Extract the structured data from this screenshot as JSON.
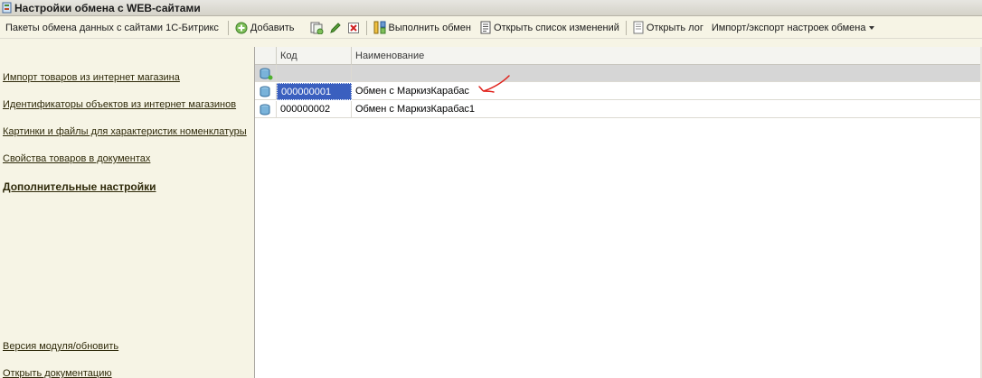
{
  "window": {
    "title": "Настройки обмена с WEB-сайтами"
  },
  "toolbar": {
    "section_label": "Пакеты обмена данных с сайтами 1С-Битрикс",
    "add_label": "Добавить",
    "run_exchange_label": "Выполнить обмен",
    "open_changes_label": "Открыть список изменений",
    "open_log_label": "Открыть лог",
    "import_export_label": "Импорт/экспорт настроек обмена"
  },
  "sidebar": {
    "links": [
      {
        "label": "Импорт товаров из интернет магазина"
      },
      {
        "label": "Идентификаторы объектов из интернет магазинов"
      },
      {
        "label": "Картинки и файлы для характеристик номенклатуры"
      },
      {
        "label": "Свойства товаров в документах"
      },
      {
        "label": "Дополнительные настройки"
      }
    ],
    "bottom_links": [
      {
        "label": "Версия модуля/обновить"
      },
      {
        "label": "Открыть документацию"
      }
    ]
  },
  "table": {
    "columns": [
      "Код",
      "Наименование"
    ],
    "group_row": {
      "code": "",
      "name": ""
    },
    "rows": [
      {
        "code": "000000001",
        "name": "Обмен с МаркизКарабас",
        "selected": true
      },
      {
        "code": "000000002",
        "name": "Обмен с МаркизКарабас1",
        "selected": false
      }
    ]
  },
  "colors": {
    "background": "#f6f4e5",
    "selection": "#3a5fbf",
    "annotation": "#e0201a",
    "link": "#2f2a0a"
  },
  "icons": [
    "window-icon",
    "add-icon",
    "copy-icon",
    "edit-icon",
    "delete-icon",
    "exchange-icon",
    "changes-list-icon",
    "log-icon",
    "db-item-icon"
  ]
}
